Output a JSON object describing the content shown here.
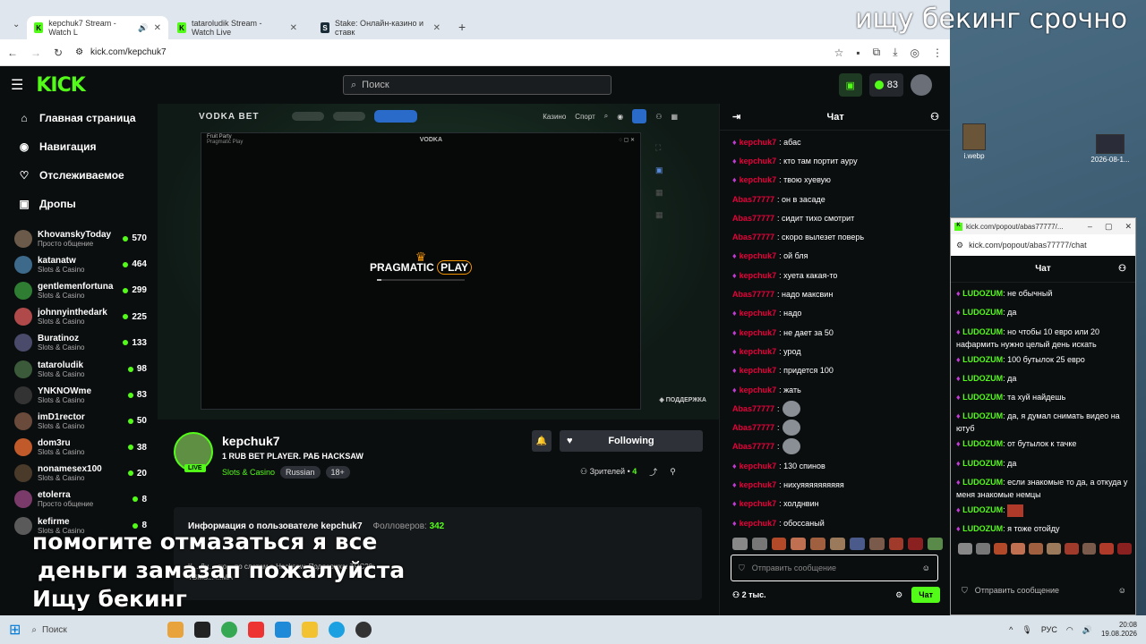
{
  "browser": {
    "tabs": [
      {
        "title": "kepchuk7 Stream - Watch L",
        "favicon": "K",
        "active": true
      },
      {
        "title": "tataroludik Stream - Watch Live",
        "favicon": "K",
        "active": false
      },
      {
        "title": "Stake: Онлайн-казино и ставк",
        "favicon": "S",
        "active": false
      }
    ],
    "url": "kick.com/kepchuk7"
  },
  "kick": {
    "logo": "KICK",
    "search_placeholder": "Поиск",
    "coins": "83",
    "nav": [
      {
        "label": "Главная страница",
        "icon": "home-icon",
        "glyph": "⌂"
      },
      {
        "label": "Навигация",
        "icon": "compass-icon",
        "glyph": "◉"
      },
      {
        "label": "Отслеживаемое",
        "icon": "heart-icon",
        "glyph": "♡"
      },
      {
        "label": "Дропы",
        "icon": "gift-icon",
        "glyph": "▣"
      }
    ],
    "channels": [
      {
        "name": "KhovanskyToday",
        "category": "Просто общение",
        "viewers": "570"
      },
      {
        "name": "katanatw",
        "category": "Slots & Casino",
        "viewers": "464"
      },
      {
        "name": "gentlemenfortuna",
        "category": "Slots & Casino",
        "viewers": "299"
      },
      {
        "name": "johnnyinthedark",
        "category": "Slots & Casino",
        "viewers": "225"
      },
      {
        "name": "Buratinoz",
        "category": "Slots & Casino",
        "viewers": "133"
      },
      {
        "name": "tataroludik",
        "category": "Slots & Casino",
        "viewers": "98"
      },
      {
        "name": "YNKNOWme",
        "category": "Slots & Casino",
        "viewers": "83"
      },
      {
        "name": "imD1rector",
        "category": "Slots & Casino",
        "viewers": "50"
      },
      {
        "name": "dom3ru",
        "category": "Slots & Casino",
        "viewers": "38"
      },
      {
        "name": "nonamesex100",
        "category": "Slots & Casino",
        "viewers": "20"
      },
      {
        "name": "etolerra",
        "category": "Просто общение",
        "viewers": "8"
      },
      {
        "name": "kefirme",
        "category": "Slots & Casino",
        "viewers": "8"
      }
    ],
    "player": {
      "site_logo": "VODKA BET",
      "nav_casino": "Казино",
      "nav_sport": "Спорт",
      "game_title": "Fruit Party",
      "game_provider": "Pragmatic Play",
      "window_logo": "VODKA",
      "loader_text_left": "PRAGMATIC",
      "loader_text_right": "PLAY",
      "loading_progress": 0.05,
      "support_label": "ПОДДЕРЖКА"
    },
    "streamer": {
      "name": "kepchuk7",
      "live_label": "LIVE",
      "title": "1 RUB BET PLAYER. РАБ HACKSAW",
      "category": "Slots & Casino",
      "tags": [
        "Russian",
        "18+"
      ],
      "follow_label": "Following",
      "viewers_label": "Зрителей •",
      "viewers_count": "4",
      "about_title": "Информация о пользователе kepchuk7",
      "followers_label": "Фолловеров:",
      "followers_count": "342",
      "about_text_1": "К... Ди... лю... по слотам в Hacksaw. Поддержка: TRC20:",
      "about_text_2": "TBMS... ...MA"
    },
    "chat": {
      "title": "Чат",
      "messages": [
        {
          "user": "kepchuk7",
          "text": ": абас",
          "badge": true,
          "emote": false
        },
        {
          "user": "kepchuk7",
          "text": ": кто там портит ауру",
          "badge": true,
          "emote": false
        },
        {
          "user": "kepchuk7",
          "text": ": твою хуевую",
          "badge": true,
          "emote": false
        },
        {
          "user": "Abas77777",
          "text": ": он в засаде",
          "badge": false,
          "emote": false
        },
        {
          "user": "Abas77777",
          "text": ": сидит тихо смотрит",
          "badge": false,
          "emote": false
        },
        {
          "user": "Abas77777",
          "text": ": скоро вылезет поверь",
          "badge": false,
          "emote": false
        },
        {
          "user": "kepchuk7",
          "text": ": ой бля",
          "badge": true,
          "emote": false
        },
        {
          "user": "kepchuk7",
          "text": ": хуета какая-то",
          "badge": true,
          "emote": false
        },
        {
          "user": "Abas77777",
          "text": ": надо максвин",
          "badge": false,
          "emote": false
        },
        {
          "user": "kepchuk7",
          "text": ": надо",
          "badge": true,
          "emote": false
        },
        {
          "user": "kepchuk7",
          "text": ": не дает за 50",
          "badge": true,
          "emote": false
        },
        {
          "user": "kepchuk7",
          "text": ": урод",
          "badge": true,
          "emote": false
        },
        {
          "user": "kepchuk7",
          "text": ": придется 100",
          "badge": true,
          "emote": false
        },
        {
          "user": "kepchuk7",
          "text": ": жать",
          "badge": true,
          "emote": false
        },
        {
          "user": "Abas77777",
          "text": ":",
          "badge": false,
          "emote": true
        },
        {
          "user": "Abas77777",
          "text": ":",
          "badge": false,
          "emote": true
        },
        {
          "user": "Abas77777",
          "text": ":",
          "badge": false,
          "emote": true
        },
        {
          "user": "kepchuk7",
          "text": ": 130 спинов",
          "badge": true,
          "emote": false
        },
        {
          "user": "kepchuk7",
          "text": ": нихуяяяяяяяяяя",
          "badge": true,
          "emote": false
        },
        {
          "user": "kepchuk7",
          "text": ": холднвин",
          "badge": true,
          "emote": false
        },
        {
          "user": "kepchuk7",
          "text": ": обоссаный",
          "badge": true,
          "emote": false
        }
      ],
      "input_placeholder": "Отправить сообщение",
      "viewer_count": "2 тыс.",
      "send_label": "Чат"
    }
  },
  "popout": {
    "window_title": "kick.com/popout/abas77777/...",
    "url": "kick.com/popout/abas77777/chat",
    "title": "Чат",
    "messages": [
      {
        "user": "LUDOZUM",
        "text": ": не обычный"
      },
      {
        "user": "LUDOZUM",
        "text": ": да"
      },
      {
        "user": "LUDOZUM",
        "text": ": но чтобы 10 евро или 20 нафармить нужно целый день искать"
      },
      {
        "user": "LUDOZUM",
        "text": ": 100 бутылок 25 евро"
      },
      {
        "user": "LUDOZUM",
        "text": ": да"
      },
      {
        "user": "LUDOZUM",
        "text": ": та хуй найдешь"
      },
      {
        "user": "LUDOZUM",
        "text": ": да, я думал снимать видео на ютуб"
      },
      {
        "user": "LUDOZUM",
        "text": ": от бутылок к тачке"
      },
      {
        "user": "LUDOZUM",
        "text": ": да"
      },
      {
        "user": "LUDOZUM",
        "text": ": если знакомые то да, а откуда у меня знакомые немцы"
      },
      {
        "user": "LUDOZUM",
        "text": ":"
      },
      {
        "user": "LUDOZUM",
        "text": ": я тоже отойду"
      }
    ],
    "input_placeholder": "Отправить сообщение"
  },
  "desktop": {
    "icon1_label": "i.webp",
    "icon2_label": "2026-08-1..."
  },
  "overlays": {
    "top": "ищу бекинг срочно",
    "bottom_line1": "помогите отмазаться я все",
    "bottom_line2": "деньги замазап пожалуйста",
    "bottom_line3": "Ищу бекинг"
  },
  "taskbar": {
    "search_placeholder": "Поиск",
    "lang": "РУС",
    "time": "20:08",
    "date": "19.08.2026"
  },
  "colors": {
    "kick_green": "#53fc18",
    "username_red": "#e9003a",
    "badge_purple": "#c23bd4"
  }
}
